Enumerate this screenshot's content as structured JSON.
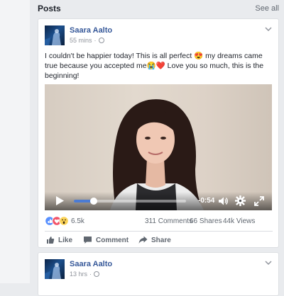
{
  "section": {
    "title": "Posts",
    "see_all": "See all"
  },
  "posts": [
    {
      "author": "Saara Aalto",
      "time": "55 mins",
      "separator": "·",
      "text": "I couldn't be happier today! This is all perfect 😍 my dreams came true because you accepted me😭❤️ Love you so much, this is the beginning!",
      "video": {
        "time_remaining": "-0:54",
        "progress_percent": 18
      },
      "reactions": {
        "icons": [
          "like",
          "love",
          "wow"
        ],
        "count": "6.5k"
      },
      "comments": "311 Comments",
      "shares": "66 Shares",
      "views": "44k Views",
      "actions": {
        "like": "Like",
        "comment": "Comment",
        "share": "Share"
      }
    },
    {
      "author": "Saara Aalto",
      "time": "13 hrs",
      "separator": "·"
    }
  ],
  "colors": {
    "link_blue": "#365899",
    "progress_blue": "#4b7bd3",
    "background": "#e9ebee",
    "like_blue": "#5890ff",
    "love_red": "#f25268",
    "wow_yellow": "#fcd458"
  }
}
